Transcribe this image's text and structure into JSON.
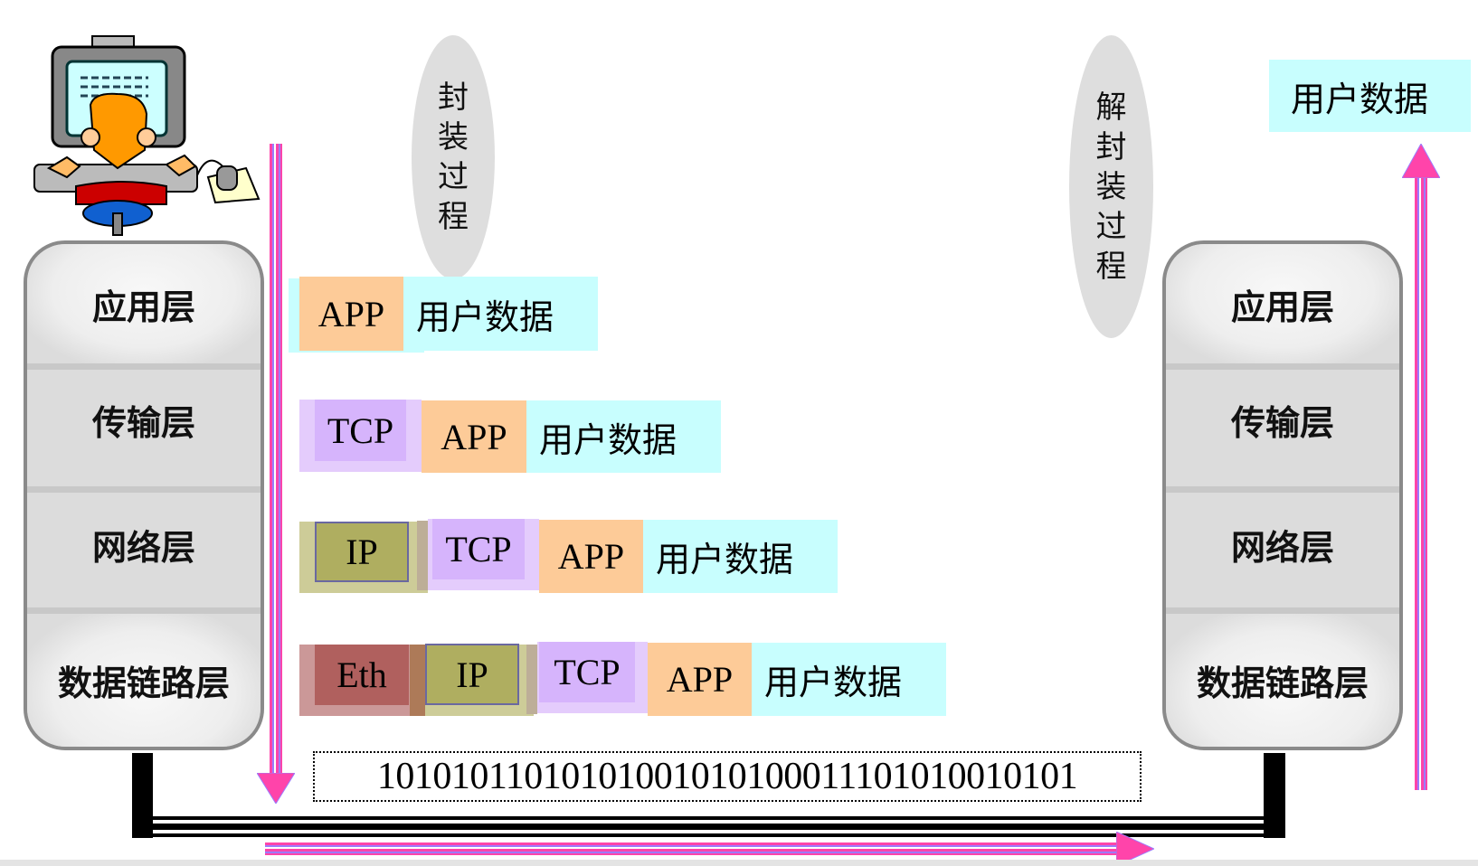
{
  "left_stack": {
    "layers": [
      "应用层",
      "传输层",
      "网络层",
      "数据链路层"
    ]
  },
  "right_stack": {
    "layers": [
      "应用层",
      "传输层",
      "网络层",
      "数据链路层"
    ]
  },
  "encapsulation_label": [
    "封",
    "装",
    "过",
    "程"
  ],
  "decapsulation_label": [
    "解",
    "封",
    "装",
    "过",
    "程"
  ],
  "received_data": "用户数据",
  "packets": {
    "app_row": {
      "app": "APP",
      "data": "用户数据"
    },
    "transport_row": {
      "tcp": "TCP",
      "app": "APP",
      "data": "用户数据"
    },
    "network_row": {
      "ip": "IP",
      "tcp": "TCP",
      "app": "APP",
      "data": "用户数据"
    },
    "link_row": {
      "eth": "Eth",
      "ip": "IP",
      "tcp": "TCP",
      "app": "APP",
      "data": "用户数据"
    }
  },
  "bitstream": "10101011010101001010100011101010010101",
  "colors": {
    "app": "#fdcb98",
    "data": "#c8fefe",
    "tcp": "#d6b4fc",
    "ip": "#afae60",
    "eth": "#b0605e",
    "arrow": "#ff44aa"
  }
}
